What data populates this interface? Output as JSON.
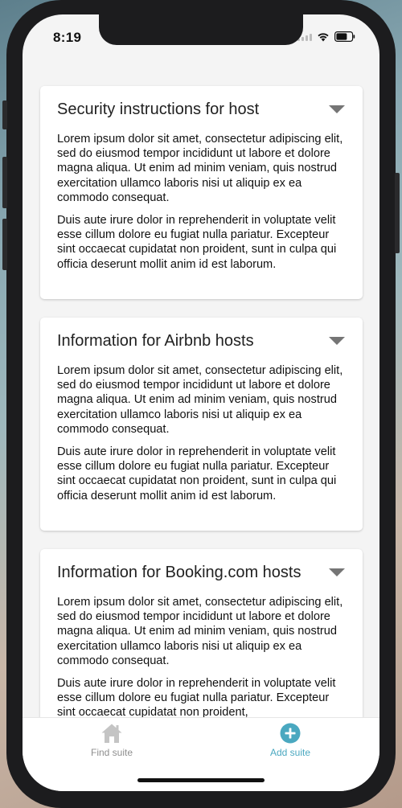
{
  "status_bar": {
    "time": "8:19"
  },
  "cards": [
    {
      "title": "Security instructions for host",
      "paragraphs": [
        "Lorem ipsum dolor sit amet, consectetur adipiscing elit, sed do eiusmod tempor incididunt ut labore et dolore magna aliqua. Ut enim ad minim veniam, quis nostrud exercitation ullamco laboris nisi ut aliquip ex ea commodo consequat.",
        "Duis aute irure dolor in reprehenderit in voluptate velit esse cillum dolore eu fugiat nulla pariatur. Excepteur sint occaecat cupidatat non proident, sunt in culpa qui officia deserunt mollit anim id est laborum."
      ]
    },
    {
      "title": "Information for Airbnb hosts",
      "paragraphs": [
        "Lorem ipsum dolor sit amet, consectetur adipiscing elit, sed do eiusmod tempor incididunt ut labore et dolore magna aliqua. Ut enim ad minim veniam, quis nostrud exercitation ullamco laboris nisi ut aliquip ex ea commodo consequat.",
        "Duis aute irure dolor in reprehenderit in voluptate velit esse cillum dolore eu fugiat nulla pariatur. Excepteur sint occaecat cupidatat non proident, sunt in culpa qui officia deserunt mollit anim id est laborum."
      ]
    },
    {
      "title": "Information for Booking.com hosts",
      "paragraphs": [
        "Lorem ipsum dolor sit amet, consectetur adipiscing elit, sed do eiusmod tempor incididunt ut labore et dolore magna aliqua. Ut enim ad minim veniam, quis nostrud exercitation ullamco laboris nisi ut aliquip ex ea commodo consequat.",
        "Duis aute irure dolor in reprehenderit in voluptate velit esse cillum dolore eu fugiat nulla pariatur. Excepteur sint occaecat cupidatat non proident,"
      ]
    }
  ],
  "icons": {
    "card_toggle": "caret-down-icon",
    "find_suite": "home-icon",
    "add_suite": "plus-circle-icon"
  },
  "tab_bar": {
    "tabs": [
      {
        "label": "Find suite",
        "active": false
      },
      {
        "label": "Add suite",
        "active": true
      }
    ]
  },
  "colors": {
    "accent": "#4aa8c0",
    "inactive_tab": "#8e8e8e",
    "caret": "#757575"
  }
}
